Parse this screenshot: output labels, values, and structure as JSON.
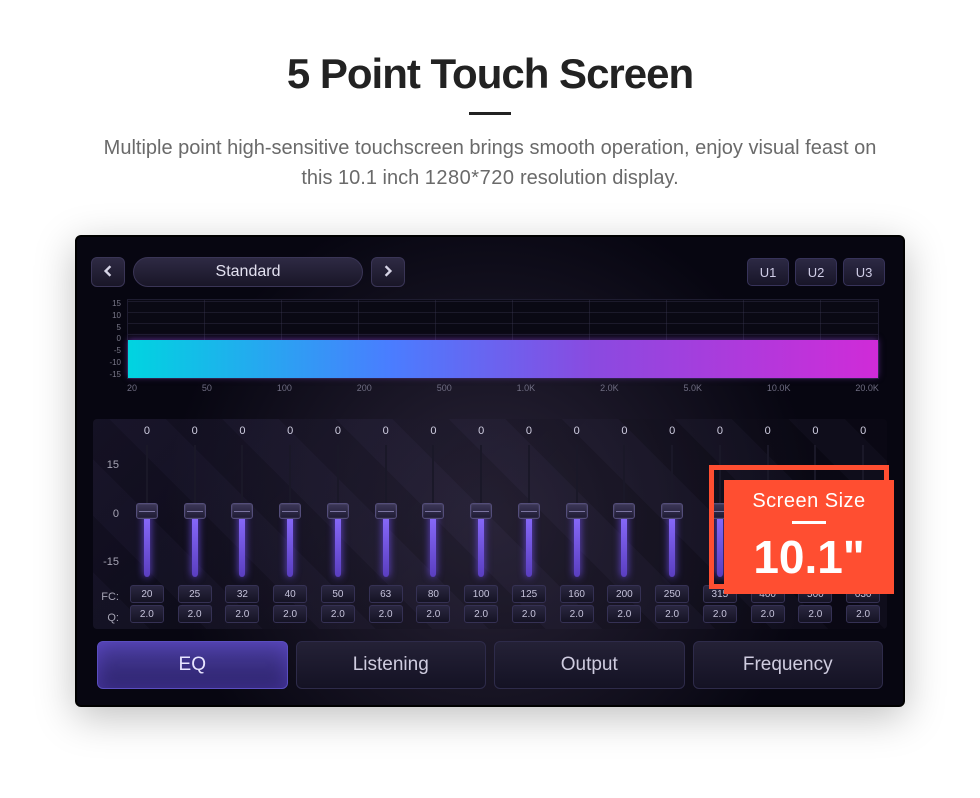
{
  "header": {
    "title": "5 Point Touch Screen",
    "subtitle_a": "Multiple point high-sensitive touchscreen brings smooth operation, enjoy visual feast on",
    "subtitle_b": "this 10.1 inch",
    "subtitle_res": "1280*720",
    "subtitle_c": "resolution display."
  },
  "badge": {
    "label": "Screen Size",
    "value": "10.1\""
  },
  "eq": {
    "preset": "Standard",
    "user_buttons": [
      "U1",
      "U2",
      "U3"
    ],
    "spectrum": {
      "y_ticks": [
        "15",
        "10",
        "5",
        "0",
        "-5",
        "-10",
        "-15"
      ],
      "x_ticks": [
        "20",
        "50",
        "100",
        "200",
        "500",
        "1.0K",
        "2.0K",
        "5.0K",
        "10.0K",
        "20.0K"
      ]
    },
    "slider_labels": {
      "top": "15",
      "mid": "0",
      "bot": "-15",
      "fc": "FC:",
      "q": "Q:"
    },
    "bands": [
      {
        "val": "0",
        "fc": "20",
        "q": "2.0"
      },
      {
        "val": "0",
        "fc": "25",
        "q": "2.0"
      },
      {
        "val": "0",
        "fc": "32",
        "q": "2.0"
      },
      {
        "val": "0",
        "fc": "40",
        "q": "2.0"
      },
      {
        "val": "0",
        "fc": "50",
        "q": "2.0"
      },
      {
        "val": "0",
        "fc": "63",
        "q": "2.0"
      },
      {
        "val": "0",
        "fc": "80",
        "q": "2.0"
      },
      {
        "val": "0",
        "fc": "100",
        "q": "2.0"
      },
      {
        "val": "0",
        "fc": "125",
        "q": "2.0"
      },
      {
        "val": "0",
        "fc": "160",
        "q": "2.0"
      },
      {
        "val": "0",
        "fc": "200",
        "q": "2.0"
      },
      {
        "val": "0",
        "fc": "250",
        "q": "2.0"
      },
      {
        "val": "0",
        "fc": "315",
        "q": "2.0"
      },
      {
        "val": "0",
        "fc": "400",
        "q": "2.0"
      },
      {
        "val": "0",
        "fc": "500",
        "q": "2.0"
      },
      {
        "val": "0",
        "fc": "630",
        "q": "2.0"
      }
    ],
    "tabs": [
      "EQ",
      "Listening",
      "Output",
      "Frequency"
    ],
    "active_tab": 0
  }
}
